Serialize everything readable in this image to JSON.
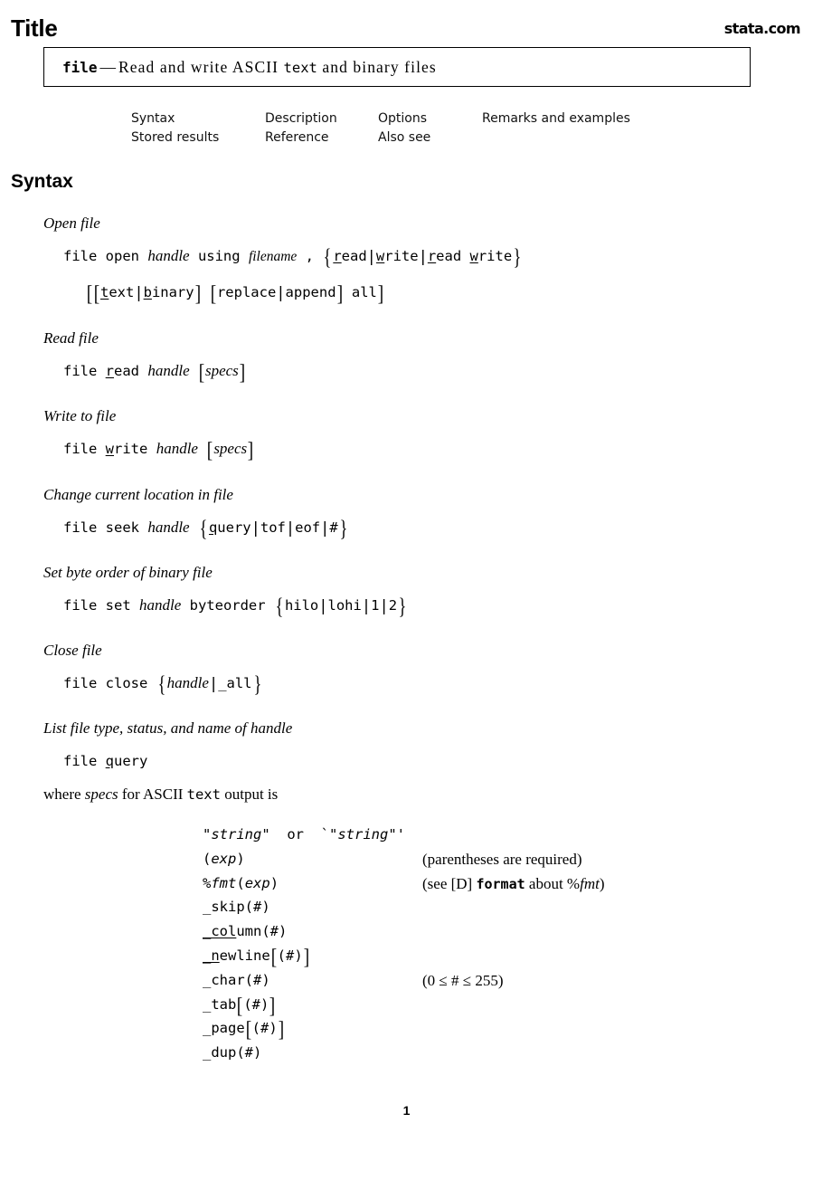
{
  "header": {
    "title": "Title",
    "brand": "stata.com"
  },
  "title_box": {
    "command": "file",
    "dash": "—",
    "description_pre": "Read and write ASCII ",
    "description_mono": "text",
    "description_post": " and binary files"
  },
  "nav": {
    "row1": [
      "Syntax",
      "Description",
      "Options",
      "Remarks and examples"
    ],
    "row2": [
      "Stored results",
      "Reference",
      "Also see"
    ]
  },
  "sections": {
    "syntax_heading": "Syntax"
  },
  "syntax": {
    "open": {
      "caption": "Open file",
      "line1": "file open handle using filename , {read|write|read write}",
      "line2": "[[text|binary] [replace|append] all]"
    },
    "read": {
      "caption": "Read file",
      "line1": "file read handle [specs]"
    },
    "write": {
      "caption": "Write to file",
      "line1": "file write handle [specs]"
    },
    "seek": {
      "caption": "Change current location in file",
      "line1": "file seek handle {query|tof|eof|#}"
    },
    "set": {
      "caption": "Set byte order of binary file",
      "line1": "file set handle byteorder {hilo|lohi|1|2}"
    },
    "close": {
      "caption": "Close file",
      "line1": "file close {handle|_all}"
    },
    "query": {
      "caption": "List file type, status, and name of handle",
      "line1": "file query"
    }
  },
  "where_line": {
    "pre": "where ",
    "italic": "specs",
    "mid": " for ASCII ",
    "mono": "text",
    "post": " output is"
  },
  "specs": [
    {
      "left": "\"string\" or `\"string\"'",
      "right": ""
    },
    {
      "left": "(exp)",
      "right": "(parentheses are required)"
    },
    {
      "left": "%fmt(exp)",
      "right": "(see [D] format about %fmt)"
    },
    {
      "left": "_skip(#)",
      "right": ""
    },
    {
      "left": "_column(#)",
      "right": ""
    },
    {
      "left": "_newline[(#)]",
      "right": ""
    },
    {
      "left": "_char(#)",
      "right": "(0 ≤ # ≤ 255)"
    },
    {
      "left": "_tab[(#)]",
      "right": ""
    },
    {
      "left": "_page[(#)]",
      "right": ""
    },
    {
      "left": "_dup(#)",
      "right": ""
    }
  ],
  "spec_notes": {
    "parentheses_required": "(parentheses are required)",
    "format_note_pre": "(see [D] ",
    "format_note_cmd": "format",
    "format_note_mid": " about %",
    "format_note_fmt": "fmt",
    "format_note_post": ")",
    "char_range": "(0 ≤ # ≤ 255)"
  },
  "footer": {
    "page_number": "1"
  },
  "colors": {
    "text": "#000000",
    "background": "#ffffff",
    "box_border": "#000000"
  }
}
